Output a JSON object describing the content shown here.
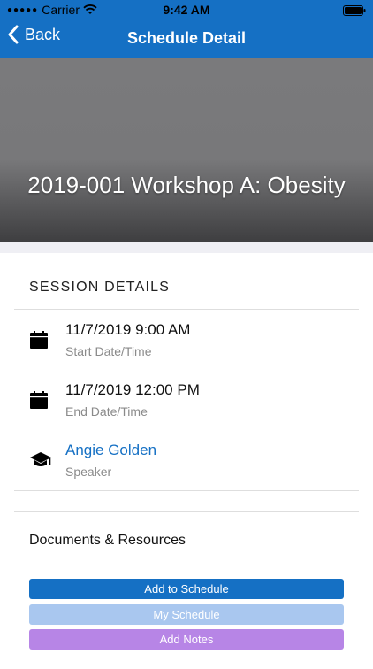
{
  "status_bar": {
    "carrier": "Carrier",
    "time": "9:42 AM"
  },
  "nav": {
    "back_label": "Back",
    "title": "Schedule Detail"
  },
  "hero": {
    "title": "2019-001 Workshop A: Obesity"
  },
  "session": {
    "header": "SESSION DETAILS",
    "rows": [
      {
        "icon": "calendar-icon",
        "value": "11/7/2019 9:00 AM",
        "label": "Start Date/Time"
      },
      {
        "icon": "calendar-icon",
        "value": "11/7/2019 12:00 PM",
        "label": "End Date/Time"
      },
      {
        "icon": "graduation-cap-icon",
        "value": "Angie Golden",
        "label": "Speaker"
      }
    ]
  },
  "documents": {
    "label": "Documents & Resources"
  },
  "buttons": {
    "add_to_schedule": "Add to Schedule",
    "my_schedule": "My Schedule",
    "add_notes": "Add Notes"
  },
  "colors": {
    "primary": "#1570c4",
    "my_schedule": "#a9c7ef",
    "add_notes": "#b785e6",
    "link": "#1570c4"
  }
}
